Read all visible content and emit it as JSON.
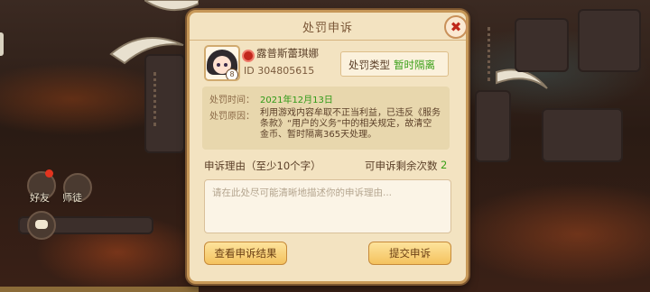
{
  "dialog": {
    "title": "处罚申诉",
    "close_symbol": "✖",
    "player": {
      "name": "露普斯蕾琪娜",
      "id": "ID 304805615",
      "avatar_badge": "8"
    },
    "punishment": {
      "type_label": "处罚类型",
      "type_value": "暂时隔离",
      "time_label": "处罚时间：",
      "time_value": "2021年12月13日",
      "reason_label": "处罚原因：",
      "reason_text": "利用游戏内容牟取不正当利益，已违反《服务条款》“用户的义务”中的相关规定，故清空金币、暂时隔离365天处理。"
    },
    "appeal": {
      "title": "申诉理由（至少10个字）",
      "remaining_label": "可申诉剩余次数",
      "remaining_count": "2",
      "placeholder": "请在此处尽可能清晰地描述你的申诉理由..."
    },
    "buttons": {
      "view_result": "查看申诉结果",
      "submit": "提交申诉"
    }
  },
  "side": {
    "friends_label": "好友",
    "group_label": "师徒"
  },
  "colors": {
    "accent_green": "#39a018",
    "panel": "#f3e3c1",
    "button": "#f4c25e"
  }
}
